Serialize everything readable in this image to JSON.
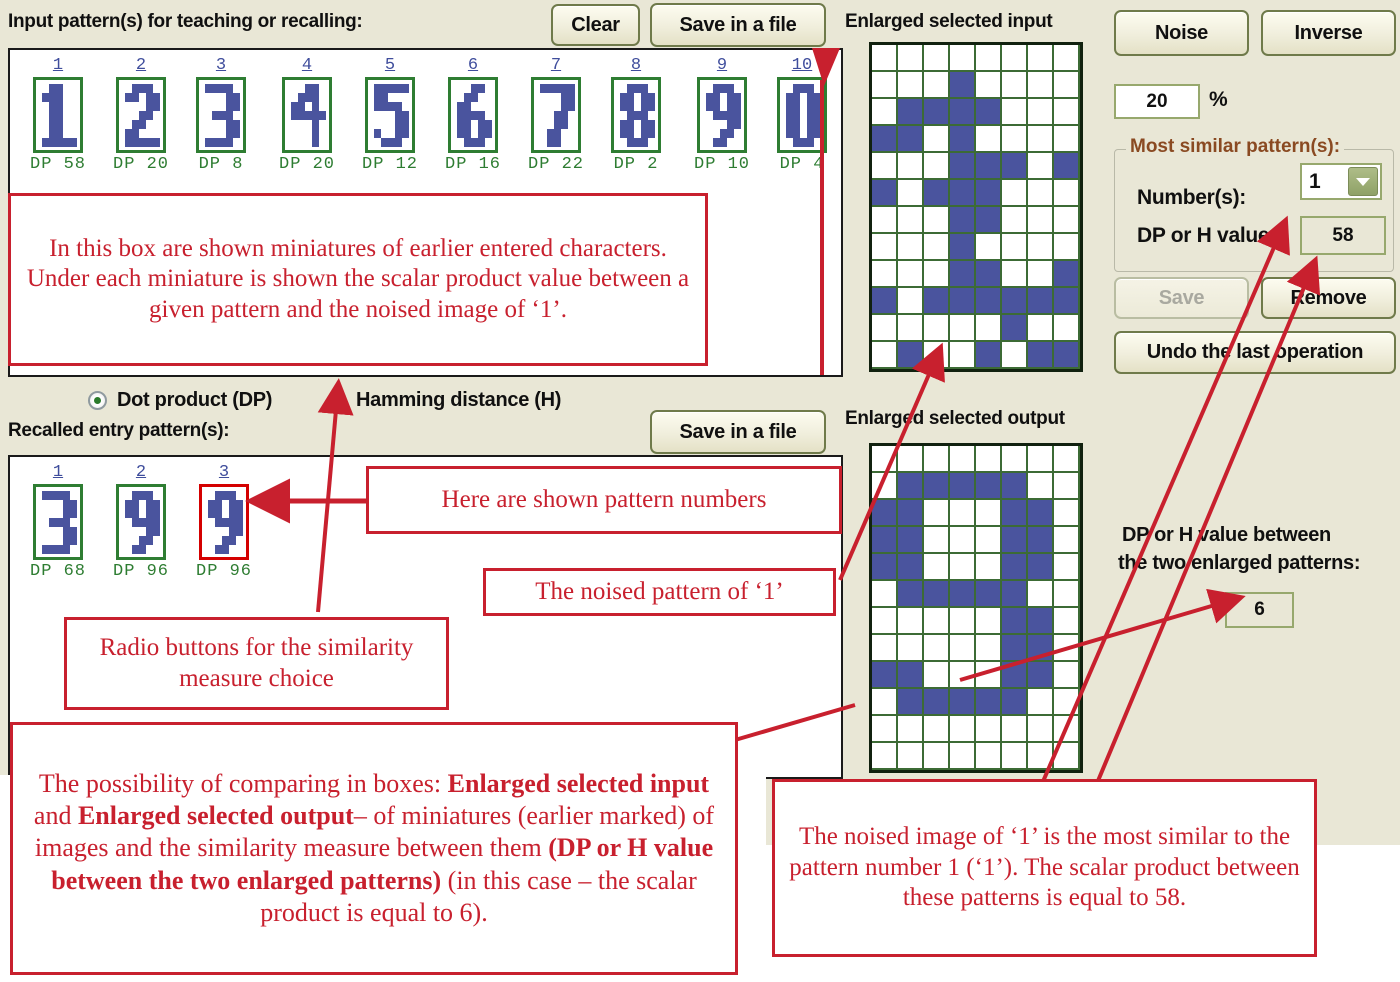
{
  "colors": {
    "background": "#e9e7d6",
    "pattern_blue": "#4a549e",
    "grid_green": "#3c6b35",
    "frame_green": "#2e7d32",
    "selected_red": "#d40000",
    "annotation_red": "#c8202e",
    "group_title_brown": "#8a4a22"
  },
  "input_section": {
    "title": "Input pattern(s) for teaching or recalling:",
    "clear_label": "Clear",
    "save_label": "Save in a file",
    "patterns": [
      {
        "index": "1",
        "digit": "1",
        "measure": "DP",
        "value": "58",
        "selected": false
      },
      {
        "index": "2",
        "digit": "2",
        "measure": "DP",
        "value": "20",
        "selected": false
      },
      {
        "index": "3",
        "digit": "3",
        "measure": "DP",
        "value": "8",
        "selected": false
      },
      {
        "index": "4",
        "digit": "4",
        "measure": "DP",
        "value": "20",
        "selected": false
      },
      {
        "index": "5",
        "digit": "5",
        "measure": "DP",
        "value": "12",
        "selected": false
      },
      {
        "index": "6",
        "digit": "6",
        "measure": "DP",
        "value": "16",
        "selected": false
      },
      {
        "index": "7",
        "digit": "7",
        "measure": "DP",
        "value": "22",
        "selected": false
      },
      {
        "index": "8",
        "digit": "8",
        "measure": "DP",
        "value": "2",
        "selected": false
      },
      {
        "index": "9",
        "digit": "9",
        "measure": "DP",
        "value": "10",
        "selected": false
      },
      {
        "index": "10",
        "digit": "0",
        "measure": "DP",
        "value": "4",
        "selected": false
      }
    ]
  },
  "similarity_radio": {
    "dot_product_label": "Dot product (DP)",
    "hamming_label": "Hamming distance (H)",
    "selected": "dot_product"
  },
  "recalled_section": {
    "title": "Recalled entry pattern(s):",
    "save_label": "Save in a file",
    "patterns": [
      {
        "index": "1",
        "digit": "3",
        "measure": "DP",
        "value": "68",
        "selected": false
      },
      {
        "index": "2",
        "digit": "9",
        "measure": "DP",
        "value": "96",
        "selected": false
      },
      {
        "index": "3",
        "digit": "9",
        "measure": "DP",
        "value": "96",
        "selected": true
      }
    ]
  },
  "enlarged_input": {
    "title": "Enlarged selected input",
    "cols": 8,
    "rows": 12,
    "cells": [
      [
        0,
        0,
        0,
        0,
        0,
        0,
        0,
        0
      ],
      [
        0,
        0,
        0,
        1,
        0,
        0,
        0,
        0
      ],
      [
        0,
        1,
        1,
        1,
        1,
        0,
        0,
        0
      ],
      [
        1,
        1,
        0,
        1,
        0,
        0,
        0,
        0
      ],
      [
        0,
        0,
        0,
        1,
        1,
        1,
        0,
        1
      ],
      [
        1,
        0,
        1,
        1,
        1,
        0,
        0,
        0
      ],
      [
        0,
        0,
        0,
        1,
        1,
        0,
        0,
        0
      ],
      [
        0,
        0,
        0,
        1,
        0,
        0,
        0,
        0
      ],
      [
        0,
        0,
        0,
        1,
        1,
        0,
        0,
        1
      ],
      [
        1,
        0,
        1,
        1,
        1,
        1,
        1,
        1
      ],
      [
        0,
        0,
        0,
        0,
        0,
        1,
        0,
        0
      ],
      [
        0,
        1,
        0,
        0,
        1,
        0,
        1,
        1
      ]
    ]
  },
  "enlarged_output": {
    "title": "Enlarged selected output",
    "cols": 8,
    "rows": 12,
    "cells": [
      [
        0,
        0,
        0,
        0,
        0,
        0,
        0,
        0
      ],
      [
        0,
        1,
        1,
        1,
        1,
        1,
        0,
        0
      ],
      [
        1,
        1,
        0,
        0,
        0,
        1,
        1,
        0
      ],
      [
        1,
        1,
        0,
        0,
        0,
        1,
        1,
        0
      ],
      [
        1,
        1,
        0,
        0,
        0,
        1,
        1,
        0
      ],
      [
        0,
        1,
        1,
        1,
        1,
        1,
        0,
        0
      ],
      [
        0,
        0,
        0,
        0,
        0,
        1,
        1,
        0
      ],
      [
        0,
        0,
        0,
        0,
        0,
        1,
        1,
        0
      ],
      [
        1,
        1,
        0,
        0,
        0,
        1,
        1,
        0
      ],
      [
        0,
        1,
        1,
        1,
        1,
        1,
        0,
        0
      ],
      [
        0,
        0,
        0,
        0,
        0,
        0,
        0,
        0
      ],
      [
        0,
        0,
        0,
        0,
        0,
        0,
        0,
        0
      ]
    ]
  },
  "right_panel": {
    "noise_label": "Noise",
    "inverse_label": "Inverse",
    "noise_percent_value": "20",
    "percent_symbol": "%",
    "group_title": "Most similar pattern(s):",
    "numbers_label": "Number(s):",
    "numbers_value": "1",
    "dp_h_value_label": "DP or H value:",
    "dp_h_value": "58",
    "save_label": "Save",
    "remove_label": "Remove",
    "undo_label": "Undo the last operation"
  },
  "compare_readout": {
    "label_line1": "DP or H value between",
    "label_line2": "the two enlarged patterns:",
    "value": "6"
  },
  "annotations": {
    "miniatures": "In this box are shown miniatures of earlier entered characters. Under each miniature is shown the scalar product value between a given pattern and the noised image of ‘1’.",
    "pattern_numbers": "Here are shown pattern numbers",
    "noised_pattern": "The noised pattern of ‘1’",
    "radio_buttons": "Radio buttons for the similarity measure choice",
    "compare_box_a": "The possibility of comparing in boxes: ",
    "compare_box_b": "Enlarged selected input",
    "compare_box_c": " and ",
    "compare_box_d": "Enlarged selected output",
    "compare_box_e": "– of miniatures (earlier marked) of images and the similarity measure between them ",
    "compare_box_f": "(DP or H value between the two enlarged patterns)",
    "compare_box_g": " (in this case – the scalar product is equal to 6).",
    "most_similar": "The noised image of ‘1’ is the most similar to the pattern number 1 (‘1’). The scalar product between these patterns is equal to 58."
  },
  "digit_bitmaps": {
    "0": [
      [
        0,
        1,
        1,
        1,
        0
      ],
      [
        1,
        1,
        0,
        1,
        1
      ],
      [
        1,
        1,
        0,
        1,
        1
      ],
      [
        1,
        1,
        0,
        1,
        1
      ],
      [
        1,
        1,
        0,
        1,
        1
      ],
      [
        1,
        1,
        0,
        1,
        1
      ],
      [
        0,
        1,
        1,
        1,
        0
      ]
    ],
    "1": [
      [
        0,
        1,
        1,
        0,
        0
      ],
      [
        1,
        1,
        1,
        0,
        0
      ],
      [
        0,
        1,
        1,
        0,
        0
      ],
      [
        0,
        1,
        1,
        0,
        0
      ],
      [
        0,
        1,
        1,
        0,
        0
      ],
      [
        0,
        1,
        1,
        0,
        0
      ],
      [
        1,
        1,
        1,
        1,
        1
      ]
    ],
    "2": [
      [
        0,
        1,
        1,
        1,
        0
      ],
      [
        1,
        1,
        0,
        1,
        1
      ],
      [
        0,
        0,
        0,
        1,
        1
      ],
      [
        0,
        0,
        1,
        1,
        0
      ],
      [
        0,
        1,
        1,
        0,
        0
      ],
      [
        1,
        1,
        0,
        0,
        0
      ],
      [
        1,
        1,
        1,
        1,
        1
      ]
    ],
    "3": [
      [
        1,
        1,
        1,
        1,
        0
      ],
      [
        0,
        0,
        0,
        1,
        1
      ],
      [
        0,
        0,
        0,
        1,
        1
      ],
      [
        0,
        1,
        1,
        1,
        0
      ],
      [
        0,
        0,
        0,
        1,
        1
      ],
      [
        0,
        0,
        0,
        1,
        1
      ],
      [
        1,
        1,
        1,
        1,
        0
      ]
    ],
    "4": [
      [
        0,
        0,
        1,
        1,
        0
      ],
      [
        0,
        1,
        1,
        1,
        0
      ],
      [
        1,
        1,
        0,
        1,
        0
      ],
      [
        1,
        1,
        1,
        1,
        1
      ],
      [
        0,
        0,
        0,
        1,
        0
      ],
      [
        0,
        0,
        0,
        1,
        0
      ],
      [
        0,
        0,
        0,
        1,
        0
      ]
    ],
    "5": [
      [
        1,
        1,
        1,
        1,
        1
      ],
      [
        1,
        1,
        0,
        0,
        0
      ],
      [
        1,
        1,
        1,
        1,
        0
      ],
      [
        0,
        0,
        0,
        1,
        1
      ],
      [
        0,
        0,
        0,
        1,
        1
      ],
      [
        1,
        0,
        0,
        1,
        1
      ],
      [
        0,
        1,
        1,
        1,
        0
      ]
    ],
    "6": [
      [
        0,
        0,
        1,
        1,
        0
      ],
      [
        0,
        1,
        1,
        0,
        0
      ],
      [
        1,
        1,
        0,
        0,
        0
      ],
      [
        1,
        1,
        1,
        1,
        0
      ],
      [
        1,
        1,
        0,
        1,
        1
      ],
      [
        1,
        1,
        0,
        1,
        1
      ],
      [
        0,
        1,
        1,
        1,
        0
      ]
    ],
    "7": [
      [
        1,
        1,
        1,
        1,
        1
      ],
      [
        0,
        0,
        0,
        1,
        1
      ],
      [
        0,
        0,
        0,
        1,
        1
      ],
      [
        0,
        0,
        1,
        1,
        0
      ],
      [
        0,
        0,
        1,
        1,
        0
      ],
      [
        0,
        1,
        1,
        0,
        0
      ],
      [
        0,
        1,
        1,
        0,
        0
      ]
    ],
    "8": [
      [
        0,
        1,
        1,
        1,
        0
      ],
      [
        1,
        1,
        0,
        1,
        1
      ],
      [
        1,
        1,
        0,
        1,
        1
      ],
      [
        0,
        1,
        1,
        1,
        0
      ],
      [
        1,
        1,
        0,
        1,
        1
      ],
      [
        1,
        1,
        0,
        1,
        1
      ],
      [
        0,
        1,
        1,
        1,
        0
      ]
    ],
    "9": [
      [
        0,
        1,
        1,
        1,
        0
      ],
      [
        1,
        1,
        0,
        1,
        1
      ],
      [
        1,
        1,
        0,
        1,
        1
      ],
      [
        0,
        1,
        1,
        1,
        1
      ],
      [
        0,
        0,
        0,
        1,
        1
      ],
      [
        0,
        0,
        1,
        1,
        0
      ],
      [
        0,
        1,
        1,
        0,
        0
      ]
    ]
  }
}
